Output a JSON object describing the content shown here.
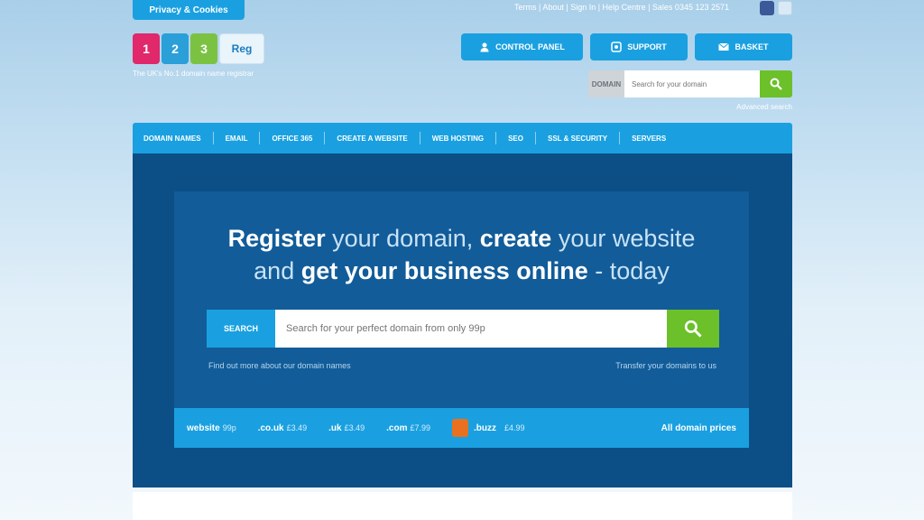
{
  "topbar": {
    "cookie_label": "Privacy & Cookies",
    "links": "Terms | About | Sign In | Help Centre | Sales 0345 123 2571"
  },
  "logo": {
    "b1": "1",
    "b2": "2",
    "b3": "3",
    "reg": "Reg",
    "tagline": "The UK's No.1 domain name registrar"
  },
  "account": {
    "control_panel": "CONTROL PANEL",
    "support": "SUPPORT",
    "basket": "BASKET"
  },
  "top_search": {
    "label": "DOMAIN",
    "placeholder": "Search for your domain",
    "advanced": "Advanced search"
  },
  "nav": [
    "DOMAIN NAMES",
    "EMAIL",
    "OFFICE 365",
    "CREATE A WEBSITE",
    "WEB HOSTING",
    "SEO",
    "SSL & SECURITY",
    "SERVERS"
  ],
  "hero": {
    "h_register": "Register",
    "h_part1": " your domain, ",
    "h_create": "create",
    "h_part2": " your website",
    "h_part3": "and ",
    "h_get": "get your business online",
    "h_part4": " - today",
    "search_label": "SEARCH",
    "search_placeholder": "Search for your perfect domain from only 99p",
    "sub_left": "Find out more about our domain names",
    "sub_right": "Transfer your domains to us"
  },
  "prices": [
    {
      "tld": "website",
      "amount": "99p"
    },
    {
      "tld": ".co.uk",
      "amount": "£3.49"
    },
    {
      "tld": ".uk",
      "amount": "£3.49"
    },
    {
      "tld": ".com",
      "amount": "£7.99"
    },
    {
      "tld": ".buzz",
      "amount": "£4.99"
    }
  ],
  "all_domains": "All domain prices"
}
